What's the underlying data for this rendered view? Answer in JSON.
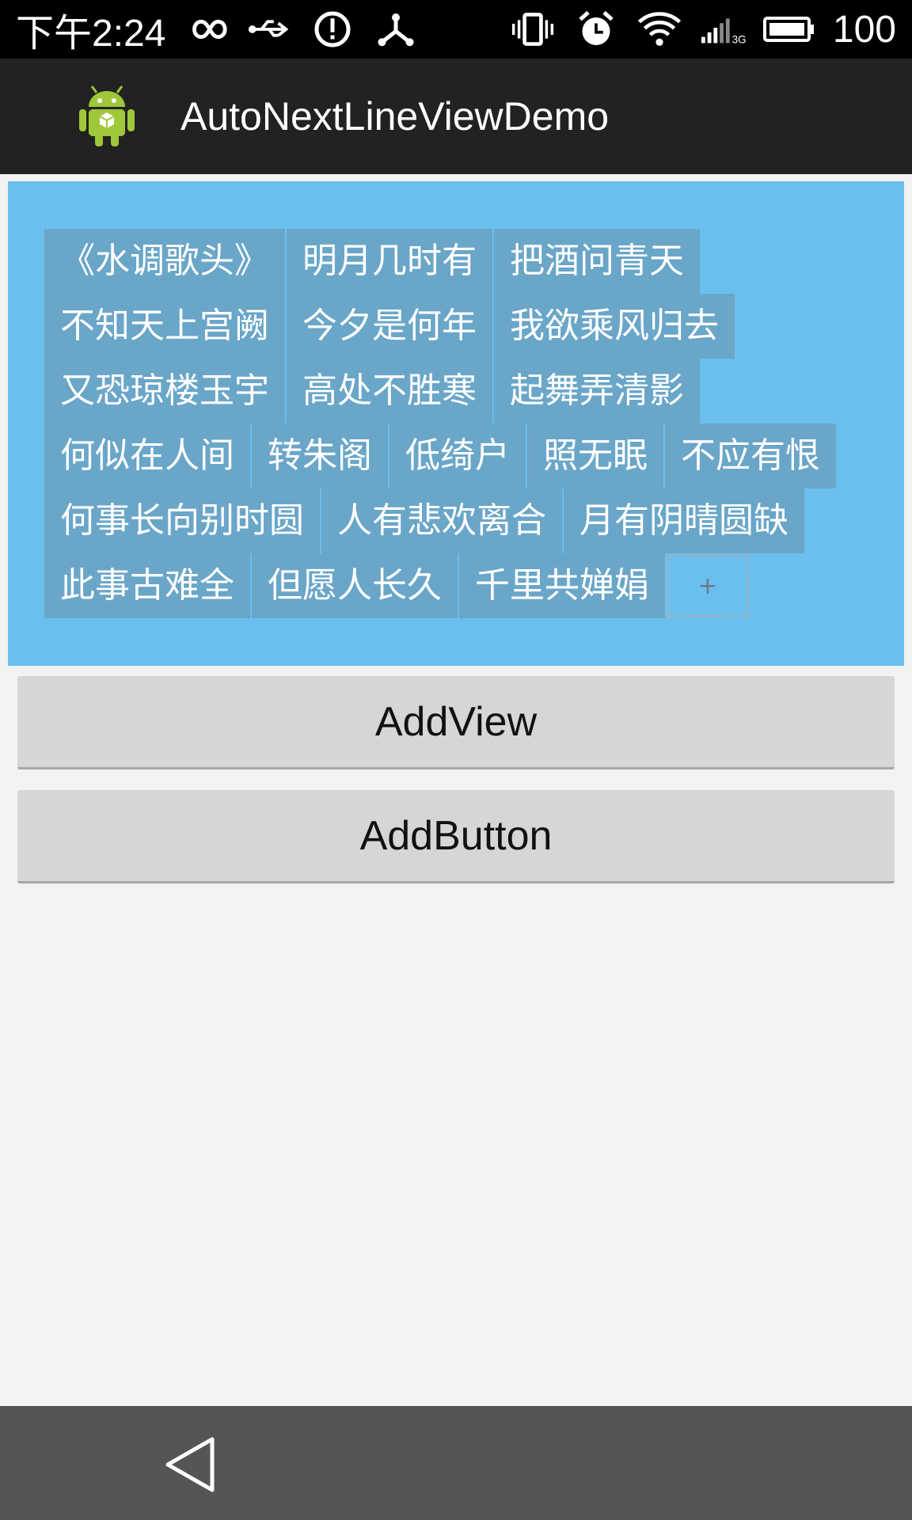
{
  "status_bar": {
    "time": "下午2:24",
    "battery": "100",
    "left_icons": [
      "infinity-icon",
      "usb-icon",
      "alert-icon",
      "share-icon"
    ],
    "right_icons": [
      "vibrate-icon",
      "alarm-icon",
      "wifi-icon",
      "signal-3g-icon",
      "battery-icon"
    ]
  },
  "action_bar": {
    "title": "AutoNextLineViewDemo",
    "logo_icon": "android-logo-icon"
  },
  "tags": [
    [
      "《水调歌头》",
      "明月几时有",
      "把酒问青天"
    ],
    [
      "不知天上宫阙",
      "今夕是何年",
      "我欲乘风归去"
    ],
    [
      "又恐琼楼玉宇",
      "高处不胜寒",
      "起舞弄清影"
    ],
    [
      "何似在人间",
      "转朱阁",
      "低绮户",
      "照无眠",
      "不应有恨"
    ],
    [
      "何事长向别时圆",
      "人有悲欢离合",
      "月有阴晴圆缺"
    ],
    [
      "此事古难全",
      "但愿人长久",
      "千里共婵娟"
    ]
  ],
  "add_tag_label": "+",
  "buttons": {
    "add_view": "AddView",
    "add_button": "AddButton"
  },
  "nav_bar": {
    "back_icon": "back-triangle-icon"
  },
  "colors": {
    "panel": "#6bbfee",
    "tag": "#6aa6c8",
    "button": "#d6d6d6",
    "nav": "#555555"
  }
}
